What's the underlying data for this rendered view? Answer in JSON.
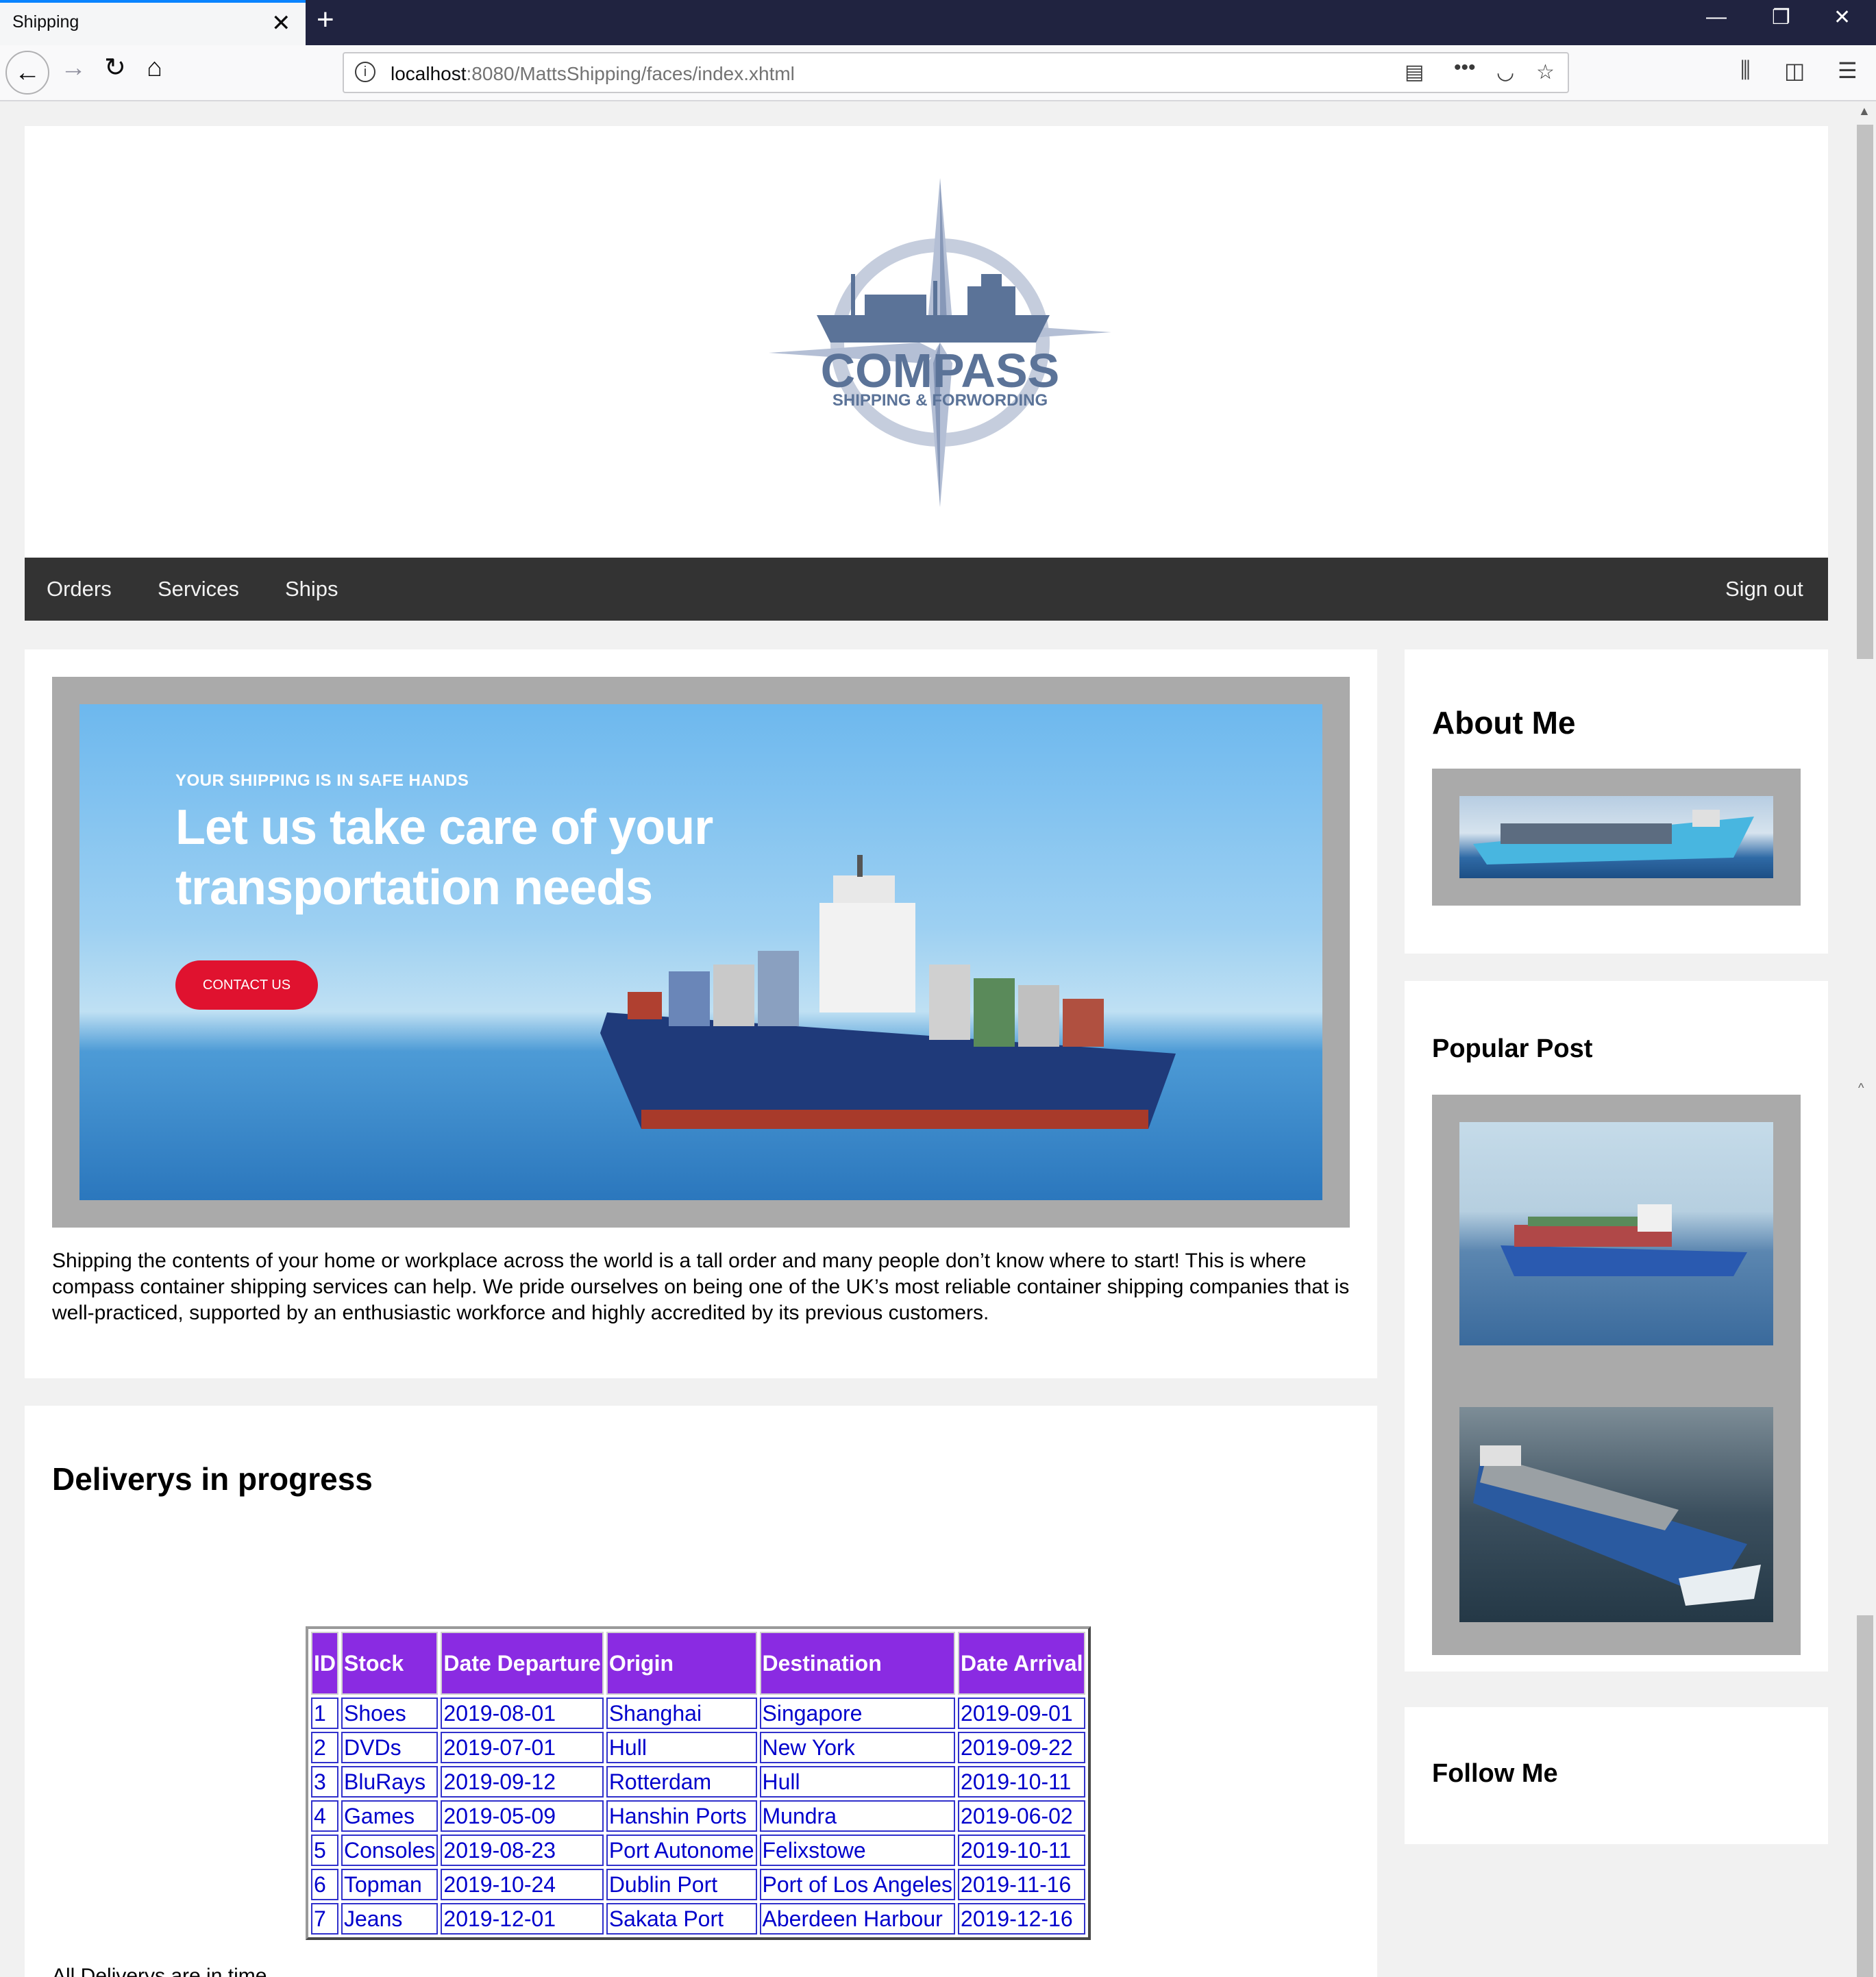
{
  "browser": {
    "tab_title": "Shipping",
    "tab_close": "✕",
    "new_tab": "+",
    "url_host": "localhost",
    "url_path": ":8080/MattsShipping/faces/index.xhtml",
    "window_minimize": "—",
    "window_restore": "❐",
    "window_close": "✕"
  },
  "logo": {
    "name": "COMPASS",
    "tagline": "SHIPPING & FORWORDING"
  },
  "nav": {
    "items": [
      {
        "label": "Orders"
      },
      {
        "label": "Services"
      },
      {
        "label": "Ships"
      }
    ],
    "sign_out": "Sign out"
  },
  "hero": {
    "kicker": "YOUR SHIPPING IS IN SAFE HANDS",
    "title": "Let us take care of your transportation needs",
    "button": "CONTACT US"
  },
  "intro_text": "Shipping the contents of your home or workplace across the world is a tall order and many people don’t know where to start! This is where compass container shipping services can help. We pride ourselves on being one of the UK’s most reliable container shipping companies that is well-practiced, supported by an enthusiastic workforce and highly accredited by its previous customers.",
  "deliveries": {
    "heading": "Deliverys in progress",
    "columns": [
      "ID",
      "Stock",
      "Date Departure",
      "Origin",
      "Destination",
      "Date Arrival"
    ],
    "rows": [
      [
        "1",
        "Shoes",
        "2019-08-01",
        "Shanghai",
        "Singapore",
        "2019-09-01"
      ],
      [
        "2",
        "DVDs",
        "2019-07-01",
        "Hull",
        "New York",
        "2019-09-22"
      ],
      [
        "3",
        "BluRays",
        "2019-09-12",
        "Rotterdam",
        "Hull",
        "2019-10-11"
      ],
      [
        "4",
        "Games",
        "2019-05-09",
        "Hanshin Ports",
        "Mundra",
        "2019-06-02"
      ],
      [
        "5",
        "Consoles",
        "2019-08-23",
        "Port Autonome",
        "Felixstowe",
        "2019-10-11"
      ],
      [
        "6",
        "Topman",
        "2019-10-24",
        "Dublin Port",
        "Port of Los Angeles",
        "2019-11-16"
      ],
      [
        "7",
        "Jeans",
        "2019-12-01",
        "Sakata Port",
        "Aberdeen Harbour",
        "2019-12-16"
      ]
    ],
    "footer": "All Deliverys are in time"
  },
  "sidebar": {
    "about_heading": "About Me",
    "popular_heading": "Popular Post",
    "follow_heading": "Follow Me"
  },
  "colors": {
    "nav_bg": "#333333",
    "table_header": "#8a2be2",
    "table_text": "#0000cc",
    "cta": "#e0122f"
  }
}
